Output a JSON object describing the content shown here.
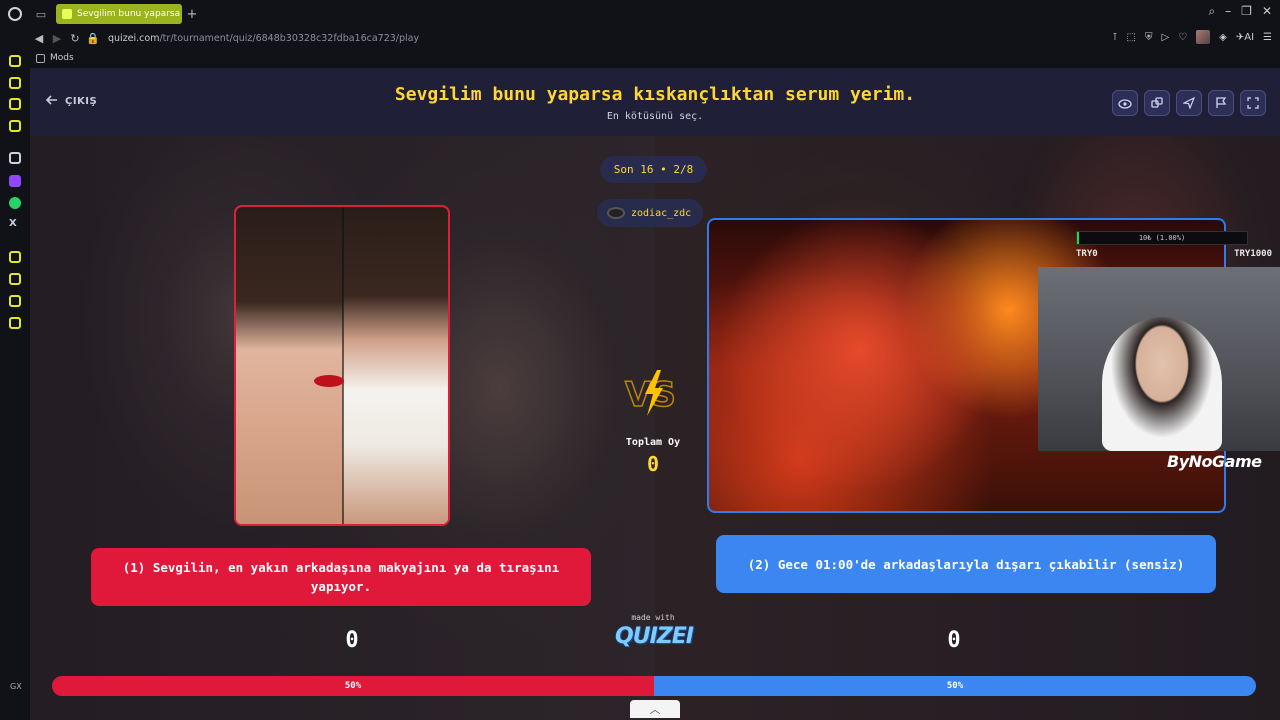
{
  "browser": {
    "tab_title": "Sevgilim bunu yaparsa kıskan",
    "url_host": "quizei.com",
    "url_path": "/tr/tournament/quiz/6848b30328c32fdba16ca723/play",
    "bookmark_label": "Mods",
    "accent_color": "#9bb31c",
    "sidebar_brand_label": "GX"
  },
  "quiz": {
    "exit_label": "ÇIKIŞ",
    "title": "Sevgilim bunu yaparsa kıskançlıktan serum yerim.",
    "subtitle": "En kötüsünü seç.",
    "round_label": "Son 16 • 2/8",
    "creator_name": "zodiac_zdc",
    "total_votes_label": "Toplam Oy",
    "total_votes_value": "0",
    "made_with_label": "made with",
    "brand_name": "QUIZEI",
    "left_option": {
      "text": "(1) Sevgilin, en yakın arkadaşına makyajını ya da tıraşını yapıyor.",
      "votes": "0",
      "percent_label": "50%",
      "percent": 50,
      "color": "#e0193a"
    },
    "right_option": {
      "text": "(2) Gece 01:00'de arkadaşlarıyla dışarı çıkabilir (sensiz)",
      "votes": "0",
      "percent_label": "50%",
      "percent": 50,
      "color": "#3b86f0"
    }
  },
  "stream_overlay": {
    "goal_progress_text": "10₺ (1.00%)",
    "goal_progress_fraction": 0.01,
    "goal_min_label": "TRY0",
    "goal_max_label": "TRY1000",
    "channel_name": "ByNoGame"
  }
}
